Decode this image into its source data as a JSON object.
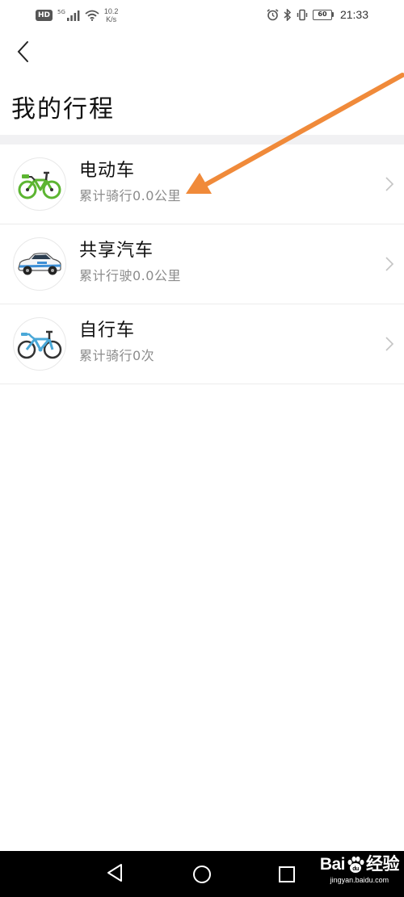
{
  "status_bar": {
    "hd": "HD",
    "net_type": "5G",
    "speed_value": "10.2",
    "speed_unit": "K/s",
    "battery": "60",
    "time": "21:33",
    "icons": [
      "signal-icon",
      "wifi-icon",
      "alarm-icon",
      "bluetooth-icon",
      "vibrate-icon",
      "battery-icon"
    ]
  },
  "header": {
    "back_icon": "chevron-left-icon",
    "title": "我的行程"
  },
  "trips": [
    {
      "name": "电动车",
      "summary": "累计骑行0.0公里",
      "icon": "e-bike-icon"
    },
    {
      "name": "共享汽车",
      "summary": "累计行驶0.0公里",
      "icon": "shared-car-icon"
    },
    {
      "name": "自行车",
      "summary": "累计骑行0次",
      "icon": "bicycle-icon"
    }
  ],
  "annotation": {
    "color": "#f08a3a",
    "points_to": "电动车"
  },
  "nav_bar": {
    "icons": [
      "nav-back-icon",
      "nav-home-icon",
      "nav-recent-icon"
    ]
  },
  "watermark": {
    "brand_left": "Bai",
    "brand_mid": "du",
    "brand_right": "经验",
    "url": "jingyan.baidu.com"
  },
  "colors": {
    "background": "#ffffff",
    "divider_band": "#f1f1f3",
    "subtitle_text": "#8c8c8c",
    "ebike_green": "#5cb531",
    "bicycle_blue": "#4aa8d8"
  }
}
